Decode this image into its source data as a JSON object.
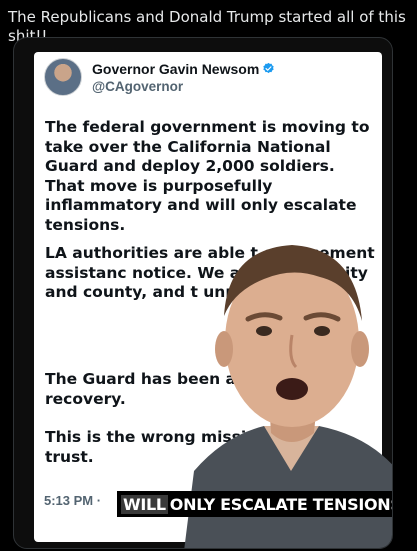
{
  "post": {
    "caption": "The Republicans and Donald Trump started all of this shit!!"
  },
  "embedded_tweet": {
    "author_name": "Governor Gavin Newsom",
    "author_handle": "@CAgovernor",
    "verified": true,
    "paragraphs": [
      "The federal government is moving to take over the California National Guard and deploy 2,000 soldiers. That move is purposefully inflammatory and will only escalate tensions.",
      "LA authorities are able t enforcement assistanc notice. We are in close city and county, and t unmet need.",
      "The Guard has been ac throughout recovery.",
      "This is the wrong mission public trust."
    ],
    "timestamp": "5:13 PM",
    "timestamp_separator": "·"
  },
  "video_overlay": {
    "caption_highlight": "WILL",
    "caption_rest": "ONLY ESCALATE TENSIONS"
  },
  "colors": {
    "background": "#000000",
    "tweet_text": "#0f1419",
    "secondary_text": "#536471",
    "verified": "#1d9bf0"
  }
}
